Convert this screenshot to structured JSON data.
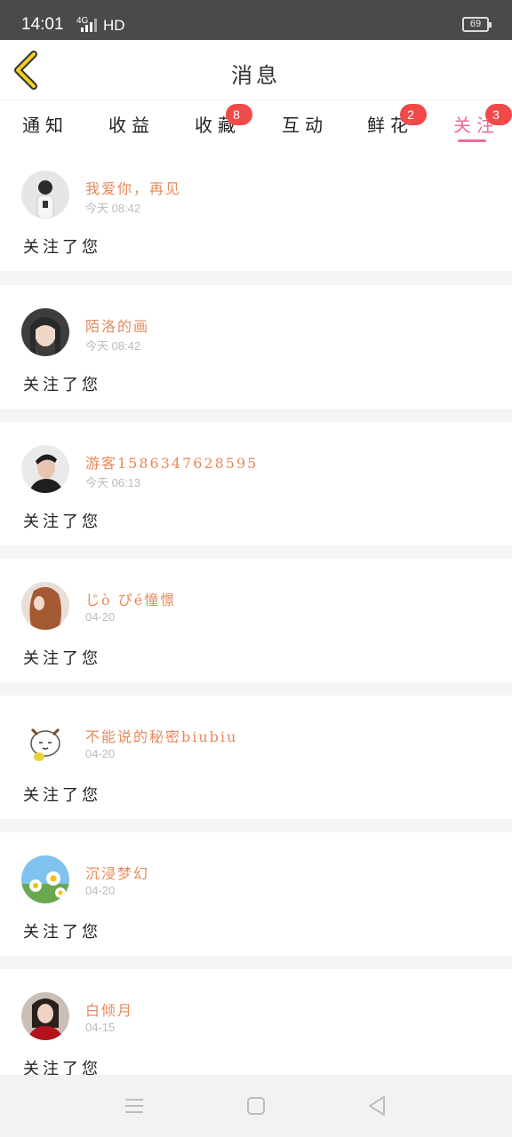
{
  "status": {
    "time": "14:01",
    "network": "4G",
    "hd": "HD",
    "battery": "69"
  },
  "header": {
    "title": "消息",
    "back_icon": "chevron-left-icon",
    "accent_color": "#f2d21b"
  },
  "tabs": [
    {
      "label": "通知",
      "badge": ""
    },
    {
      "label": "收益",
      "badge": ""
    },
    {
      "label": "收藏",
      "badge": "8"
    },
    {
      "label": "互动",
      "badge": ""
    },
    {
      "label": "鲜花",
      "badge": "2"
    },
    {
      "label": "关注",
      "badge": "3",
      "active": true
    }
  ],
  "colors": {
    "active_tab": "#ea6a99",
    "name": "#e8885a",
    "badge": "#f04a4a"
  },
  "notifications": [
    {
      "name": "我爱你，再见",
      "time": "今天 08:42",
      "message": "关注了您"
    },
    {
      "name": "陌洛的画",
      "time": "今天 08:42",
      "message": "关注了您"
    },
    {
      "name": "游客1586347628595",
      "time": "今天 06:13",
      "message": "关注了您"
    },
    {
      "name": "じò ぴé憧憬",
      "time": "04-20",
      "message": "关注了您"
    },
    {
      "name": "不能说的秘密biubiu",
      "time": "04-20",
      "message": "关注了您"
    },
    {
      "name": "沉浸梦幻",
      "time": "04-20",
      "message": "关注了您"
    },
    {
      "name": "白倾月",
      "time": "04-15",
      "message": "关注了您"
    }
  ],
  "nav": {
    "menu_icon": "menu-icon",
    "home_icon": "home-square-icon",
    "back_icon": "back-triangle-icon"
  }
}
